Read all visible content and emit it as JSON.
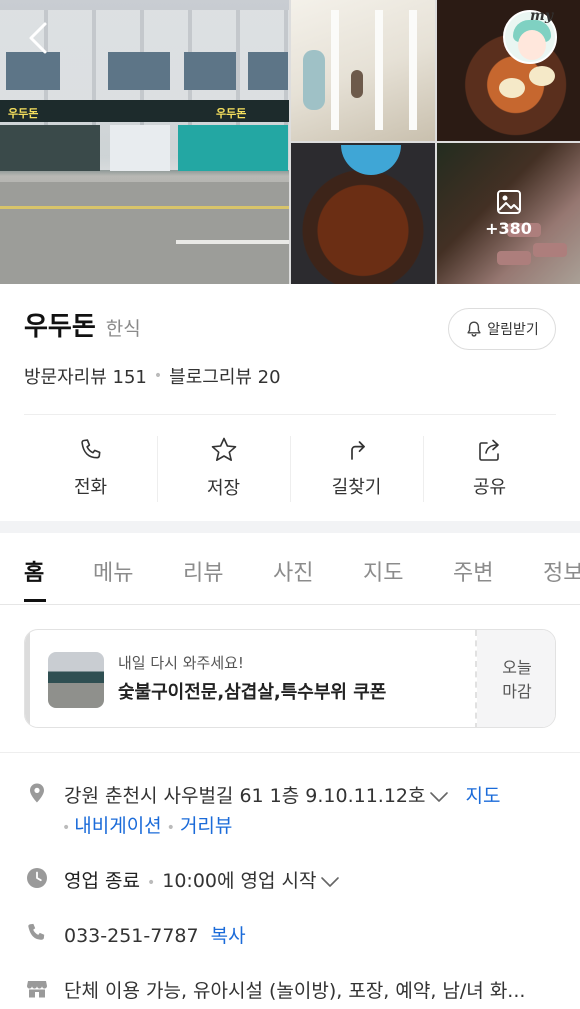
{
  "header": {
    "back_icon": "chevron-left-icon",
    "storefront_signs": [
      "우두돈",
      "우두돈"
    ],
    "photo_more_count": "+380",
    "photo_more_icon": "image-icon",
    "profile_badge": "my"
  },
  "place": {
    "name": "우두돈",
    "category": "한식",
    "alarm_label": "알림받기",
    "visitor_review_label": "방문자리뷰 151",
    "blog_review_label": "블로그리뷰 20"
  },
  "actions": [
    {
      "label": "전화",
      "icon": "phone-icon"
    },
    {
      "label": "저장",
      "icon": "star-icon"
    },
    {
      "label": "길찾기",
      "icon": "directions-icon"
    },
    {
      "label": "공유",
      "icon": "share-icon"
    }
  ],
  "tabs": [
    "홈",
    "메뉴",
    "리뷰",
    "사진",
    "지도",
    "주변",
    "정보"
  ],
  "active_tab": "홈",
  "coupon": {
    "subtitle": "내일 다시 와주세요!",
    "title": "숯불구이전문,삼겹살,특수부위 쿠폰",
    "status_line1": "오늘",
    "status_line2": "마감"
  },
  "info": {
    "address": "강원 춘천시 사우벌길 61 1층 9.10.11.12호",
    "map_link": "지도",
    "navigation_link": "내비게이션",
    "distance_link": "거리뷰",
    "hours_status": "영업 종료",
    "hours_detail": "10:00에 영업 시작",
    "phone": "033-251-7787",
    "copy_link": "복사",
    "facilities": "단체 이용 가능, 유아시설 (놀이방), 포장, 예약, 남/녀 화..."
  },
  "colors": {
    "link": "#1b6bd9",
    "divider": "#eeeeee",
    "band": "#f2f3f5"
  }
}
